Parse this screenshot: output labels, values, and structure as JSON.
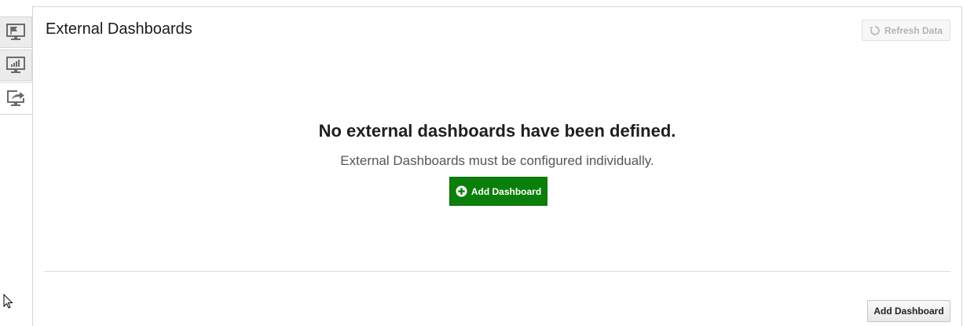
{
  "rail": {
    "tabs": [
      {
        "icon": "flag-monitor-icon",
        "selected": false
      },
      {
        "icon": "chart-monitor-icon",
        "selected": false
      },
      {
        "icon": "share-monitor-icon",
        "selected": true
      }
    ]
  },
  "panel": {
    "title": "External Dashboards",
    "refresh_label": "Refresh Data",
    "refresh_icon": "refresh-icon",
    "empty_heading": "No external dashboards have been defined.",
    "empty_subtext": "External Dashboards must be configured individually.",
    "add_primary_label": "Add Dashboard",
    "add_primary_icon": "plus-circle-icon",
    "add_secondary_label": "Add Dashboard"
  },
  "colors": {
    "accent_green": "#0a7f0a",
    "disabled_text": "#b3b3b3",
    "border": "#d6d6d6"
  }
}
